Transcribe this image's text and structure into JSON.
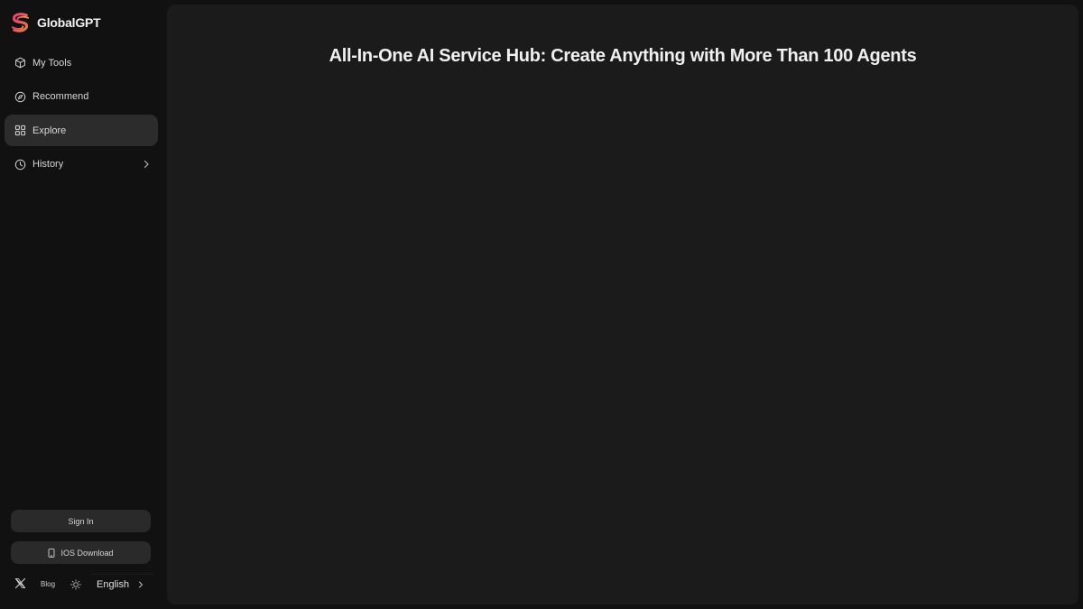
{
  "brand": {
    "name": "GlobalGPT",
    "logo_icon": "globalgpt-s-logo",
    "logo_colors": [
      "#e8417a",
      "#f07a3a",
      "#d9356f"
    ]
  },
  "nav": {
    "items": [
      {
        "label": "My Tools",
        "icon": "cube-icon",
        "active": false
      },
      {
        "label": "Recommend",
        "icon": "compass-icon",
        "active": false
      },
      {
        "label": "Explore",
        "icon": "grid-icon",
        "active": true
      },
      {
        "label": "History",
        "icon": "clock-icon",
        "active": false,
        "has_submenu": true
      }
    ]
  },
  "actions": {
    "sign_in_label": "Sign In",
    "ios_download_label": "IOS Download"
  },
  "footer": {
    "blog_label": "Blog",
    "language": "English"
  },
  "main": {
    "headline": "All-In-One AI Service Hub: Create Anything with More Than 100 Agents"
  },
  "colors": {
    "page_bg": "#111111",
    "panel_bg": "#1b1b1b",
    "active_item_bg": "#2c2c2c",
    "button_bg": "#2a2a2a",
    "text": "#e6e6e6"
  }
}
